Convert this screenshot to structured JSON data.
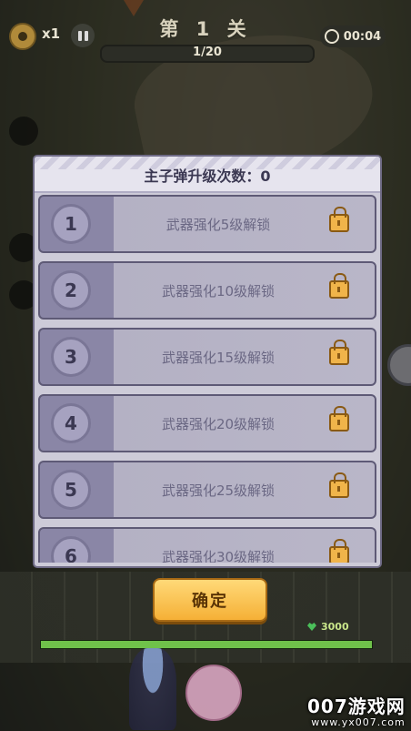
{
  "hud": {
    "speed": "x1",
    "level_title": "第 1 关",
    "wave": "1/20",
    "timer": "00:04",
    "gear_color": "#b08a3a"
  },
  "modal": {
    "title": "主子弹升级次数：0",
    "rows": [
      {
        "number": "1",
        "label": "武器强化5级解锁",
        "icon": "lock-icon"
      },
      {
        "number": "2",
        "label": "武器强化10级解锁",
        "icon": "lock-icon"
      },
      {
        "number": "3",
        "label": "武器强化15级解锁",
        "icon": "lock-icon"
      },
      {
        "number": "4",
        "label": "武器强化20级解锁",
        "icon": "lock-icon"
      },
      {
        "number": "5",
        "label": "武器强化25级解锁",
        "icon": "lock-icon"
      },
      {
        "number": "6",
        "label": "武器强化30级解锁",
        "icon": "lock-icon"
      }
    ]
  },
  "confirm_label": "确定",
  "coins": "3000",
  "hp_fraction": 1.0,
  "watermark": {
    "brand": "007游戏网",
    "url": "www.yx007.com"
  },
  "colors": {
    "accent": "#f5b036",
    "lock": "#f0b44a",
    "row": "#b4b1c4"
  }
}
